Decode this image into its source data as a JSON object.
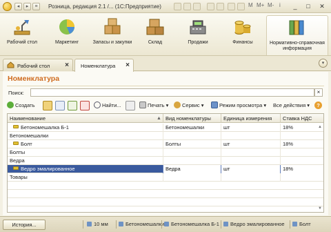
{
  "window": {
    "title": "Розница, редакция 2.1 /... (1С:Предприятие)",
    "controls": {
      "minimize": "_",
      "maximize": "□",
      "close": "✕"
    }
  },
  "sections": [
    {
      "label": "Рабочий стол",
      "icon": "desk-lamp-icon"
    },
    {
      "label": "Маркетинг",
      "icon": "pie-chart-icon"
    },
    {
      "label": "Запасы и закупки",
      "icon": "boxes-icon"
    },
    {
      "label": "Склад",
      "icon": "warehouse-boxes-icon"
    },
    {
      "label": "Продажи",
      "icon": "cash-register-icon"
    },
    {
      "label": "Финансы",
      "icon": "coin-stacks-icon"
    },
    {
      "label": "Нормативно-справочная информация",
      "icon": "binders-icon"
    }
  ],
  "tabs": [
    {
      "label": "Рабочий стол"
    },
    {
      "label": "Номенклатура"
    }
  ],
  "form": {
    "title": "Номенклатура",
    "search_label": "Поиск:",
    "search_value": ""
  },
  "commands": {
    "create": "Создать",
    "find": "Найти...",
    "print": "Печать",
    "service": "Сервис",
    "view_mode": "Режим просмотра",
    "all_actions": "Все действия",
    "help": "?"
  },
  "table": {
    "columns": [
      "Наименование",
      "Вид номенклатуры",
      "Единица измерения",
      "Ставка НДС"
    ],
    "rows": [
      {
        "name": "Бетономешалка Б-1",
        "kind": "Бетономешалки",
        "unit": "шт",
        "vat": "18%",
        "icon": true,
        "indent": true
      },
      {
        "name": "Бетономешалки",
        "kind": "",
        "unit": "",
        "vat": "",
        "icon": false,
        "indent": false
      },
      {
        "name": "Болт",
        "kind": "Болты",
        "unit": "шт",
        "vat": "18%",
        "icon": true,
        "indent": true
      },
      {
        "name": "Болты",
        "kind": "",
        "unit": "",
        "vat": "",
        "icon": false,
        "indent": false
      },
      {
        "name": "Ведра",
        "kind": "",
        "unit": "",
        "vat": "",
        "icon": false,
        "indent": false
      },
      {
        "name": "Ведро эмалированное",
        "kind": "Ведра",
        "unit": "шт",
        "vat": "18%",
        "icon": true,
        "indent": true,
        "selected": true
      },
      {
        "name": "Товары",
        "kind": "",
        "unit": "",
        "vat": "",
        "icon": false,
        "indent": false
      }
    ]
  },
  "status": {
    "history_button": "История...",
    "items": [
      "10 мм",
      "Бетономешалки",
      "Бетономешалка Б-1",
      "Ведро эмалированное",
      "Болт"
    ]
  },
  "colors": {
    "accent_title": "#cf6b1e",
    "selection": "#3a5a9e"
  }
}
